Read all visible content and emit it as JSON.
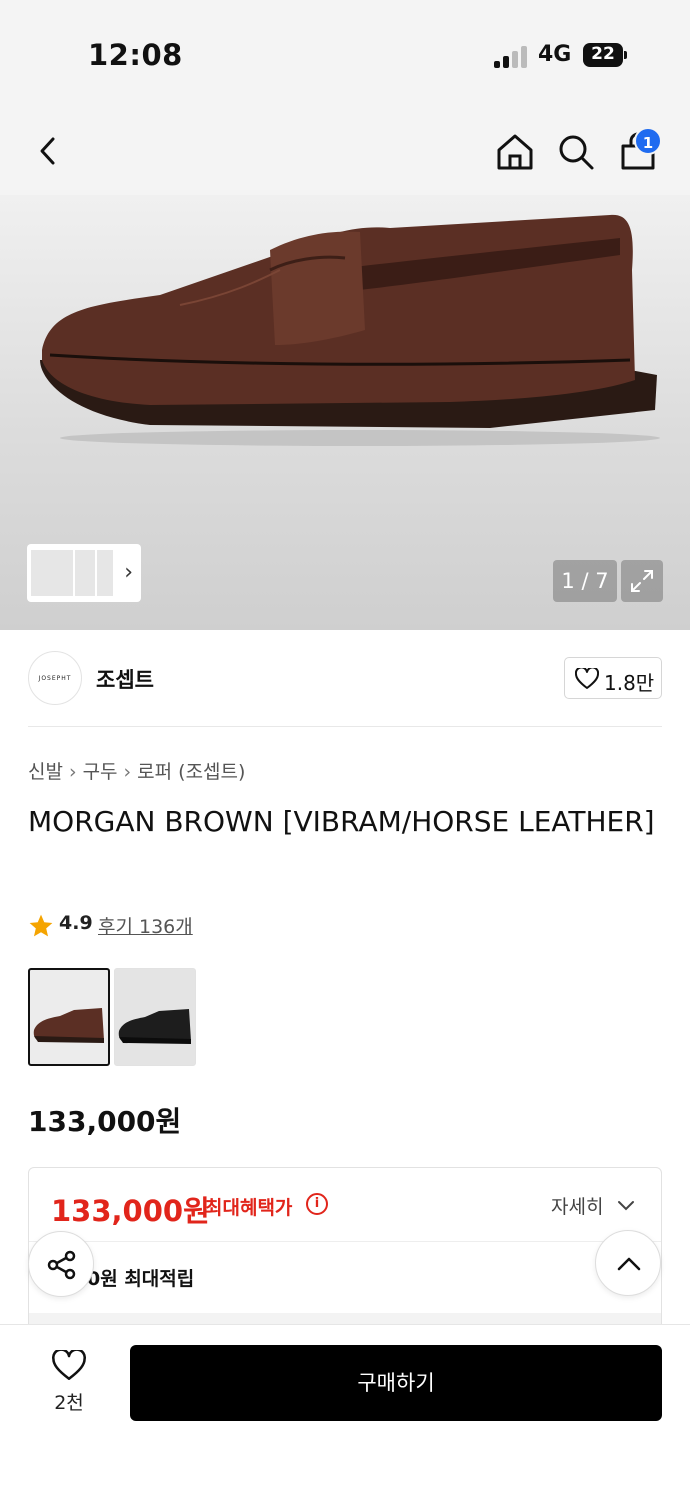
{
  "status_bar": {
    "time": "12:08",
    "network": "4G",
    "battery": "22"
  },
  "nav": {
    "cart_count": "1"
  },
  "gallery": {
    "counter": "1 / 7"
  },
  "brand": {
    "logo_text": "JOSEPHT",
    "name": "조셉트",
    "like_count": "1.8만"
  },
  "breadcrumb": {
    "items": [
      "신발",
      "구두",
      "로퍼 (조셉트)"
    ]
  },
  "product": {
    "title": "MORGAN BROWN [VIBRAM/HORSE LEATHER]",
    "rating": "4.9",
    "review_text": "후기 136개",
    "price": "133,000원"
  },
  "benefit": {
    "price": "133,000원",
    "label": "최대혜택가",
    "detail_link": "자세히",
    "points": "0원 최대적립"
  },
  "bottom_bar": {
    "wish_count": "2천",
    "buy_label": "구매하기"
  },
  "colors": {
    "accent_red": "#e1251b",
    "badge_blue": "#1f6bf0",
    "buy_button": "#000000"
  }
}
